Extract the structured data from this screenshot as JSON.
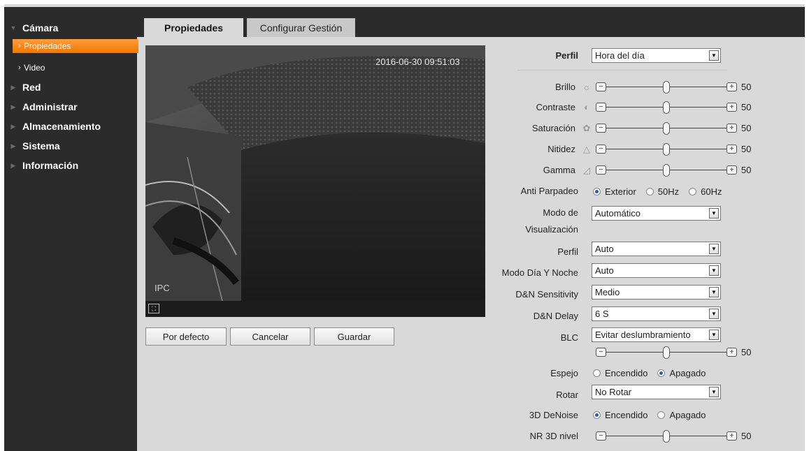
{
  "sidebar": {
    "items": [
      {
        "label": "Cámara"
      },
      {
        "label": "Red"
      },
      {
        "label": "Administrar"
      },
      {
        "label": "Almacenamiento"
      },
      {
        "label": "Sistema"
      },
      {
        "label": "Información"
      }
    ],
    "camera_sub": [
      {
        "label": "Propiedades"
      },
      {
        "label": "Video"
      }
    ]
  },
  "tabs": [
    {
      "label": "Propiedades"
    },
    {
      "label": "Configurar Gestión"
    }
  ],
  "video": {
    "timestamp": "2016-06-30 09:51:03",
    "overlay": "IPC"
  },
  "buttons": {
    "default": "Por defecto",
    "cancel": "Cancelar",
    "save": "Guardar"
  },
  "form": {
    "profile": {
      "label": "Perfil",
      "value": "Hora del día"
    },
    "brightness": {
      "label": "Brillo",
      "value": "50"
    },
    "contrast": {
      "label": "Contraste",
      "value": "50"
    },
    "saturation": {
      "label": "Saturación",
      "value": "50"
    },
    "sharpness": {
      "label": "Nitidez",
      "value": "50"
    },
    "gamma": {
      "label": "Gamma",
      "value": "50"
    },
    "anti_flicker": {
      "label": "Anti Parpadeo",
      "options": [
        "Exterior",
        "50Hz",
        "60Hz"
      ],
      "selected": "Exterior"
    },
    "display_mode": {
      "label_line1": "Modo de",
      "label_line2": "Visualización",
      "value": "Automático"
    },
    "profile2": {
      "label": "Perfil",
      "value": "Auto"
    },
    "day_night": {
      "label": "Modo Día Y Noche",
      "value": "Auto"
    },
    "dn_sensitivity": {
      "label": "D&N Sensitivity",
      "value": "Medio"
    },
    "dn_delay": {
      "label": "D&N Delay",
      "value": "6 S"
    },
    "blc": {
      "label": "BLC",
      "value": "Evitar deslumbramiento",
      "level": "50"
    },
    "mirror": {
      "label": "Espejo",
      "options": [
        "Encendido",
        "Apagado"
      ],
      "selected": "Apagado"
    },
    "rotate": {
      "label": "Rotar",
      "value": "No Rotar"
    },
    "denoise_3d": {
      "label": "3D DeNoise",
      "options": [
        "Encendido",
        "Apagado"
      ],
      "selected": "Encendido"
    },
    "nr3d_level": {
      "label": "NR 3D nivel",
      "value": "50"
    }
  },
  "colors": {
    "sidebar_bg": "#2b2b2b",
    "active_item": "#f07800",
    "panel_bg": "#d9d9d9"
  }
}
